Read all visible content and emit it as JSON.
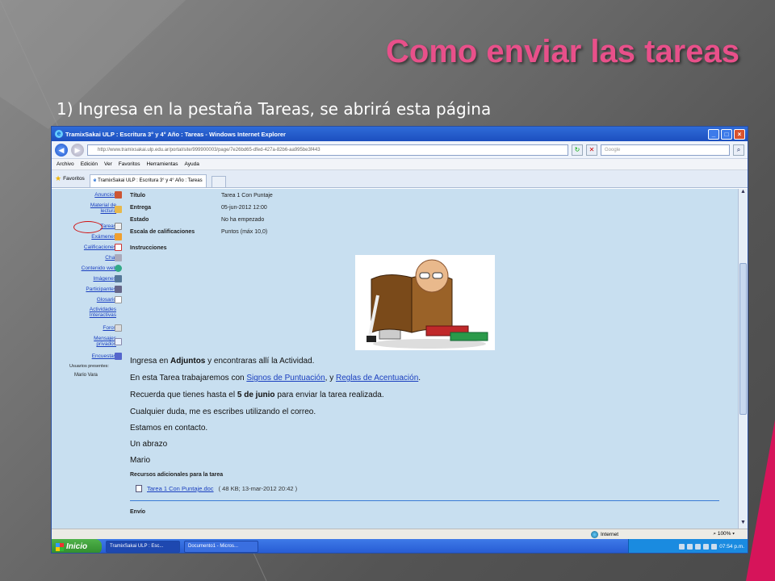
{
  "slide": {
    "title": "Como enviar las tareas",
    "instruction": "1) Ingresa en la pestaña Tareas, se abrirá esta página"
  },
  "browser": {
    "window_title": "TramixSakai ULP : Escritura 3° y 4° Año : Tareas - Windows Internet Explorer",
    "address": "http://www.tramixsakai.ulp.edu.ar/portal/site/999900003/page/7e26bd65-dfed-427a-82b6-aa995be3f443",
    "search_placeholder": "Google",
    "menu": [
      "Archivo",
      "Edición",
      "Ver",
      "Favoritos",
      "Herramientas",
      "Ayuda"
    ],
    "favorites_label": "Favoritos",
    "tab_label": "TramixSakai ULP : Escritura 3° y 4° Año : Tareas"
  },
  "sidebar": {
    "items": [
      {
        "label": "Anuncios",
        "icon": "megaphone-icon"
      },
      {
        "label": "Material de lectura",
        "icon": "folder-icon"
      },
      {
        "label": "Tareas",
        "icon": "assignment-icon"
      },
      {
        "label": "Exámenes",
        "icon": "pencil-icon"
      },
      {
        "label": "Calificaciones",
        "icon": "gradebook-icon"
      },
      {
        "label": "Chat",
        "icon": "chat-icon"
      },
      {
        "label": "Contenido web",
        "icon": "web-icon"
      },
      {
        "label": "Imágenes",
        "icon": "image-icon"
      },
      {
        "label": "Participantes",
        "icon": "people-icon"
      },
      {
        "label": "Glosario",
        "icon": "list-icon"
      },
      {
        "label": "Actividades Interactivas",
        "icon": "activity-icon"
      },
      {
        "label": "Foros",
        "icon": "forum-icon"
      },
      {
        "label": "Mensajes privados",
        "icon": "message-icon"
      },
      {
        "label": "Encuestas",
        "icon": "poll-icon"
      }
    ],
    "presentes_label": "Usuarios presentes:",
    "presentes_user": "Mario Vara"
  },
  "assignment": {
    "rows": [
      {
        "key": "Título",
        "value": "Tarea 1 Con Puntaje"
      },
      {
        "key": "Entrega",
        "value": "05-jun-2012 12:00"
      },
      {
        "key": "Estado",
        "value": "No ha empezado"
      },
      {
        "key": "Escala de calificaciones",
        "value": "Puntos (máx 10,0)"
      }
    ],
    "instructions_label": "Instrucciones",
    "p1_pre": "Ingresa en ",
    "p1_bold": "Adjuntos",
    "p1_post": " y encontraras allí la Actividad.",
    "p2_pre": "En esta Tarea trabajaremos con ",
    "p2_link1": "Signos de Puntuación",
    "p2_mid": ", y ",
    "p2_link2": "Reglas de Acentuación",
    "p2_post": ".",
    "p3_pre": "Recuerda que tienes hasta el ",
    "p3_bold": "5 de junio",
    "p3_post": " para enviar la tarea realizada.",
    "p4": "Cualquier duda, me es escribes utilizando el correo.",
    "p5": "Estamos en contacto.",
    "p6": "Un abrazo",
    "p7": "Mario",
    "resources_label": "Recursos adicionales para la tarea",
    "attachment_name": "Tarea 1 Con Puntaje.doc",
    "attachment_meta": "( 48 KB; 13-mar-2012 20:42 )",
    "envio_label": "Envío"
  },
  "status": {
    "zone": "Internet",
    "zoom": "100%"
  },
  "taskbar": {
    "start_label": "Inicio",
    "tasks": [
      "TramixSakai ULP : Esc...",
      "Documento1 - Micros..."
    ],
    "clock": "07:54 p.m."
  }
}
